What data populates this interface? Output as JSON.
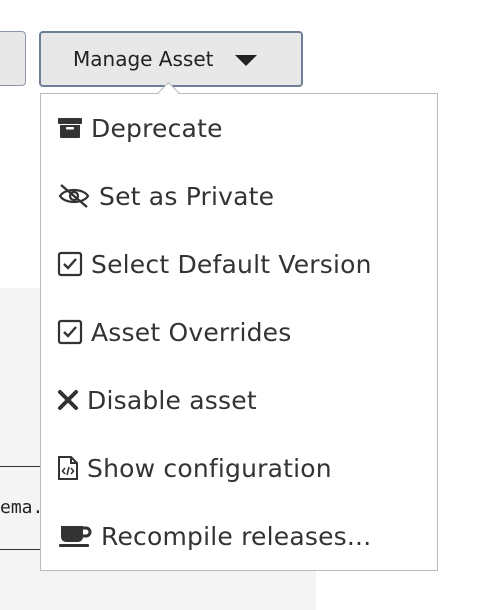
{
  "toolbar": {
    "manage_label": "Manage Asset"
  },
  "background": {
    "snippet": "ema."
  },
  "menu": {
    "items": [
      {
        "label": "Deprecate",
        "icon": "archive-icon"
      },
      {
        "label": "Set as Private",
        "icon": "eye-slash-icon"
      },
      {
        "label": "Select Default Version",
        "icon": "check-square-icon"
      },
      {
        "label": "Asset Overrides",
        "icon": "check-square-icon"
      },
      {
        "label": "Disable asset",
        "icon": "x-icon"
      },
      {
        "label": "Show configuration",
        "icon": "file-code-icon"
      },
      {
        "label": "Recompile releases...",
        "icon": "coffee-cup-icon"
      }
    ]
  }
}
